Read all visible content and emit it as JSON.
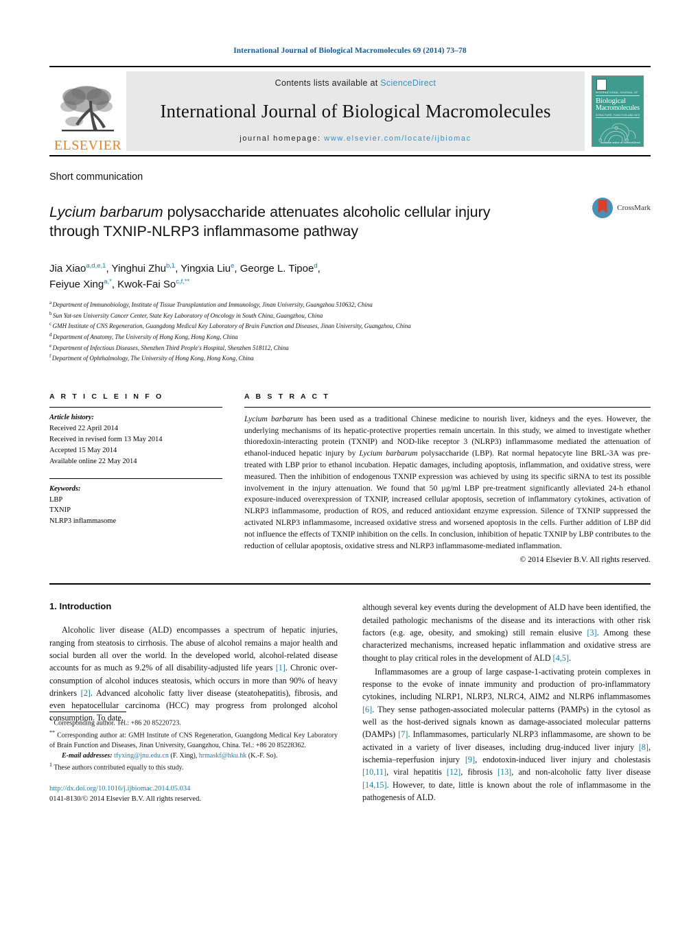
{
  "running_head": "International Journal of Biological Macromolecules 69 (2014) 73–78",
  "masthead": {
    "publisher_name": "ELSEVIER",
    "contents_prefix": "Contents lists available at ",
    "sciencedirect": "ScienceDirect",
    "journal_title": "International Journal of Biological Macromolecules",
    "homepage_prefix": "journal homepage: ",
    "homepage_url": "www.elsevier.com/locate/ijbiomac",
    "cover": {
      "superline": "INTERNATIONAL JOURNAL OF",
      "title_line1": "Biological",
      "title_line2": "Macromolecules",
      "subtitle": "STRUCTURE, FUNCTION AND INTERACTIONS",
      "footer": "Available online at\nScienceDirect"
    },
    "accent_link_color": "#3a8fbf",
    "elsevier_orange": "#f08020",
    "cover_bg": "#3f9b8e"
  },
  "article_type": "Short communication",
  "title": {
    "italic_lead": "Lycium barbarum",
    "rest_line1": " polysaccharide attenuates alcoholic cellular injury",
    "line2": "through TXNIP-NLRP3 inflammasome pathway"
  },
  "crossmark": {
    "label": "CrossMark"
  },
  "authors_html": "Jia Xiao<sup>a,d,e,1</sup>, Yinghui Zhu<sup>b,1</sup>, Yingxia Liu<sup>e</sup>, George L. Tipoe<sup>d</sup>,<br>Feiyue Xing<sup>a,*</sup>, Kwok-Fai So<sup>c,f,**</sup>",
  "affiliations": [
    {
      "mark": "a",
      "text": "Department of Immunobiology, Institute of Tissue Transplantation and Immunology, Jinan University, Guangzhou 510632, China"
    },
    {
      "mark": "b",
      "text": "Sun Yat-sen University Cancer Center, State Key Laboratory of Oncology in South China, Guangzhou, China"
    },
    {
      "mark": "c",
      "text": "GMH Institute of CNS Regeneration, Guangdong Medical Key Laboratory of Brain Function and Diseases, Jinan University, Guangzhou, China"
    },
    {
      "mark": "d",
      "text": "Department of Anatomy, The University of Hong Kong, Hong Kong, China"
    },
    {
      "mark": "e",
      "text": "Department of Infectious Diseases, Shenzhen Third People's Hospital, Shenzhen 518112, China"
    },
    {
      "mark": "f",
      "text": "Department of Ophthalmology, The University of Hong Kong, Hong Kong, China"
    }
  ],
  "article_info": {
    "heading": "A R T I C L E    I N F O",
    "history_label": "Article history:",
    "history": [
      "Received 22 April 2014",
      "Received in revised form 13 May 2014",
      "Accepted 15 May 2014",
      "Available online 22 May 2014"
    ],
    "keywords_label": "Keywords:",
    "keywords": [
      "LBP",
      "TXNIP",
      "NLRP3 inflammasome"
    ]
  },
  "abstract": {
    "heading": "A B S T R A C T",
    "body_html": "<span class=\"ital\">Lycium barbarum</span> has been used as a traditional Chinese medicine to nourish liver, kidneys and the eyes. However, the underlying mechanisms of its hepatic-protective properties remain uncertain. In this study, we aimed to investigate whether thioredoxin-interacting protein (TXNIP) and NOD-like receptor 3 (NLRP3) inflammasome mediated the attenuation of ethanol-induced hepatic injury by <span class=\"ital\">Lycium barbarum</span> polysaccharide (LBP). Rat normal hepatocyte line BRL-3A was pre-treated with LBP prior to ethanol incubation. Hepatic damages, including apoptosis, inflammation, and oxidative stress, were measured. Then the inhibition of endogenous TXNIP expression was achieved by using its specific siRNA to test its possible involvement in the injury attenuation. We found that 50 &micro;g/ml LBP pre-treatment significantly alleviated 24-h ethanol exposure-induced overexpression of TXNIP, increased cellular apoptosis, secretion of inflammatory cytokines, activation of NLRP3 inflammasome, production of ROS, and reduced antioxidant enzyme expression. Silence of TXNIP suppressed the activated NLRP3 inflammasome, increased oxidative stress and worsened apoptosis in the cells. Further addition of LBP did not influence the effects of TXNIP inhibition on the cells. In conclusion, inhibition of hepatic TXNIP by LBP contributes to the reduction of cellular apoptosis, oxidative stress and NLRP3 inflammasome-mediated inflammation.",
    "copyright": "© 2014 Elsevier B.V. All rights reserved."
  },
  "body": {
    "section_heading": "1.  Introduction",
    "left_paragraph_html": "Alcoholic liver disease (ALD) encompasses a spectrum of hepatic injuries, ranging from steatosis to cirrhosis. The abuse of alcohol remains a major health and social burden all over the world. In the developed world, alcohol-related disease accounts for as much as 9.2% of all disability-adjusted life years <span class=\"ref\">[1]</span>. Chronic over-consumption of alcohol induces steatosis, which occurs in more than 90% of heavy drinkers <span class=\"ref\">[2]</span>. Advanced alcoholic fatty liver disease (steatohepatitis), fibrosis, and even hepatocellular carcinoma (HCC) may progress from prolonged alcohol consumption. To date,",
    "right_paragraph1_html": "although several key events during the development of ALD have been identified, the detailed pathologic mechanisms of the disease and its interactions with other risk factors (e.g. age, obesity, and smoking) still remain elusive <span class=\"ref\">[3]</span>. Among these characterized mechanisms, increased hepatic inflammation and oxidative stress are thought to play critical roles in the development of ALD <span class=\"ref\">[4,5]</span>.",
    "right_paragraph2_html": "Inflammasomes are a group of large caspase-1-activating protein complexes in response to the evoke of innate immunity and production of pro-inflammatory cytokines, including NLRP1, NLRP3, NLRC4, AIM2 and NLRP6 inflammasomes <span class=\"ref\">[6]</span>. They sense pathogen-associated molecular patterns (PAMPs) in the cytosol as well as the host-derived signals known as damage-associated molecular patterns (DAMPs) <span class=\"ref\">[7]</span>. Inflammasomes, particularly NLRP3 inflammasome, are shown to be activated in a variety of liver diseases, including drug-induced liver injury <span class=\"ref\">[8]</span>, ischemia–reperfusion injury <span class=\"ref\">[9]</span>, endotoxin-induced liver injury and cholestasis <span class=\"ref\">[10,11]</span>, viral hepatitis <span class=\"ref\">[12]</span>, fibrosis <span class=\"ref\">[13]</span>, and non-alcoholic fatty liver disease <span class=\"ref\">[14,15]</span>. However, to date, little is known about the role of inflammasome in the pathogenesis of ALD."
  },
  "footnotes": {
    "corresponding_1_html": "<sup>*</sup>  Corresponding author. Tel.: +86 20 85220723.",
    "corresponding_2_html": "<sup>**</sup>  Corresponding author at: GMH Institute of CNS Regeneration, Guangdong Medical Key Laboratory of Brain Function and Diseases, Jinan University, Guangzhou, China. Tel.: +86 20 85228362.",
    "email_html": "<span class=\"em\">E-mail addresses:</span> <span class=\"lnk\">tfyxing@jnu.edu.cn</span> (F. Xing), <span class=\"lnk\">hrmaskf@hku.hk</span> (K.-F. So).",
    "equal_contrib_html": "<sup>1</sup>  These authors contributed equally to this study.",
    "doi": "http://dx.doi.org/10.1016/j.ijbiomac.2014.05.034",
    "issn": "0141-8130/© 2014 Elsevier B.V. All rights reserved."
  }
}
